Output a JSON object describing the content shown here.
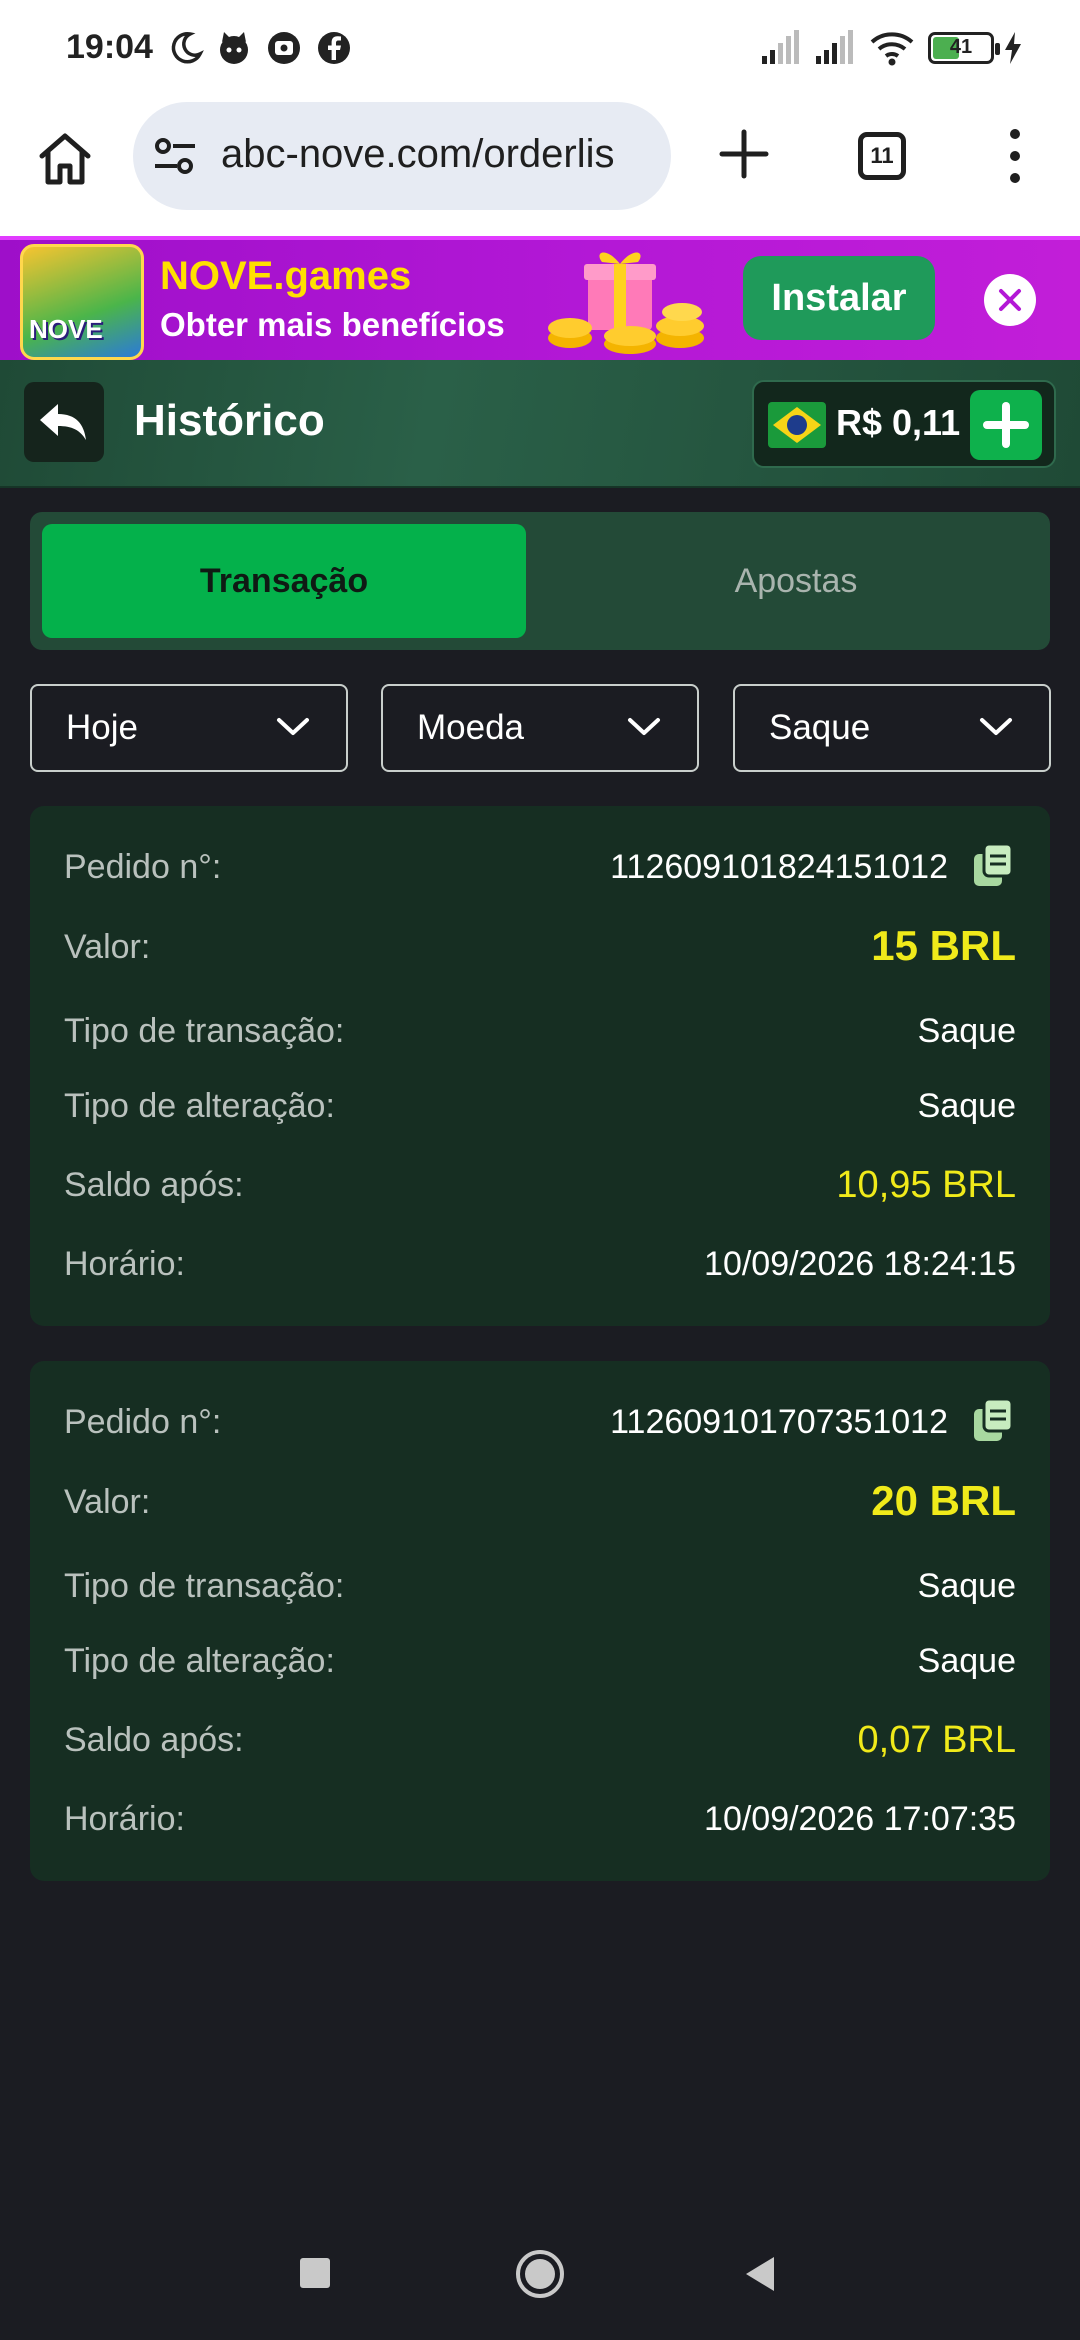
{
  "status_bar": {
    "time": "19:04",
    "battery": "41",
    "icons": [
      "moon-icon",
      "cat-icon",
      "screen-record-icon",
      "facebook-icon",
      "signal-icon",
      "signal-icon",
      "wifi-icon",
      "battery-icon",
      "charging-icon"
    ]
  },
  "browser": {
    "url": "abc-nove.com/orderlis",
    "tab_count": "11"
  },
  "banner": {
    "logo_text": "NOVE",
    "title": "NOVE.games",
    "subtitle": "Obter mais benefícios",
    "install_label": "Instalar"
  },
  "header": {
    "title": "Histórico",
    "balance": "R$ 0,11"
  },
  "tabs": [
    {
      "label": "Transação",
      "active": true
    },
    {
      "label": "Apostas",
      "active": false
    }
  ],
  "filters": [
    {
      "label": "Hoje"
    },
    {
      "label": "Moeda"
    },
    {
      "label": "Saque"
    }
  ],
  "labels": {
    "order_no": "Pedido n°:",
    "amount": "Valor:",
    "transaction_type": "Tipo de transação:",
    "change_type": "Tipo de alteração:",
    "balance_after": "Saldo após:",
    "time": "Horário:"
  },
  "transactions": [
    {
      "order_no": "112609101824151012",
      "amount": "15 BRL",
      "transaction_type": "Saque",
      "change_type": "Saque",
      "balance_after": "10,95 BRL",
      "time": "10/09/2026 18:24:15"
    },
    {
      "order_no": "112609101707351012",
      "amount": "20 BRL",
      "transaction_type": "Saque",
      "change_type": "Saque",
      "balance_after": "0,07 BRL",
      "time": "10/09/2026 17:07:35"
    }
  ],
  "colors": {
    "accent_green": "#04b14b",
    "amount_yellow": "#f0ea1a",
    "card_bg": "#162e22",
    "page_bg": "#1b1c22"
  }
}
